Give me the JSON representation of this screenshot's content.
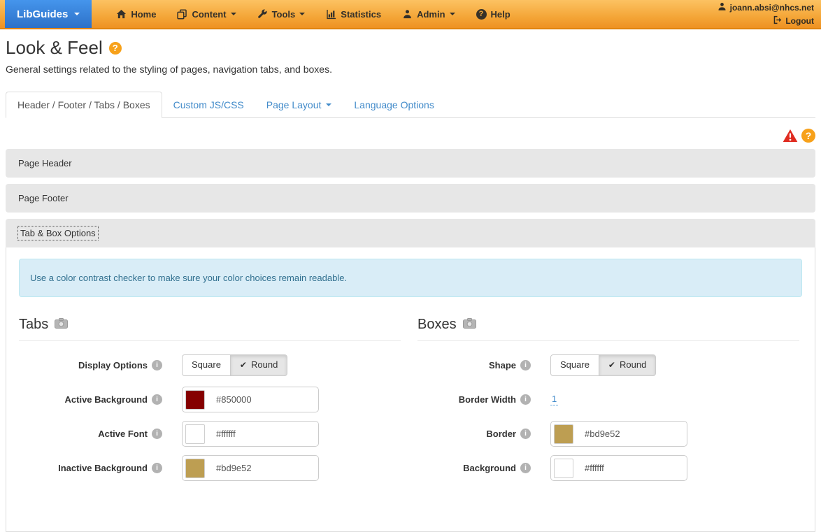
{
  "navbar": {
    "brand": "LibGuides",
    "items": [
      {
        "label": "Home",
        "icon": "home-icon"
      },
      {
        "label": "Content",
        "icon": "content-icon",
        "caret": true
      },
      {
        "label": "Tools",
        "icon": "tools-icon",
        "caret": true
      },
      {
        "label": "Statistics",
        "icon": "statistics-icon"
      },
      {
        "label": "Admin",
        "icon": "admin-icon",
        "caret": true
      },
      {
        "label": "Help",
        "icon": "help-icon"
      }
    ],
    "user_email": "joann.absi@nhcs.net",
    "logout_label": "Logout"
  },
  "page": {
    "title": "Look & Feel",
    "subtitle": "General settings related to the styling of pages, navigation tabs, and boxes."
  },
  "tabs": [
    {
      "label": "Header / Footer / Tabs / Boxes",
      "active": true
    },
    {
      "label": "Custom JS/CSS",
      "active": false
    },
    {
      "label": "Page Layout",
      "active": false,
      "caret": true
    },
    {
      "label": "Language Options",
      "active": false
    }
  ],
  "accordion": {
    "page_header": "Page Header",
    "page_footer": "Page Footer",
    "tab_box_options": "Tab & Box Options"
  },
  "alert": {
    "text": "Use a color contrast checker to make sure your color choices remain readable."
  },
  "tabs_section": {
    "heading": "Tabs",
    "fields": [
      {
        "label": "Display Options",
        "type": "toggle",
        "options": [
          "Square",
          "Round"
        ],
        "selected": "Round"
      },
      {
        "label": "Active Background",
        "value": "#850000",
        "swatch": "#850000"
      },
      {
        "label": "Active Font",
        "value": "#ffffff",
        "swatch": "#ffffff"
      },
      {
        "label": "Inactive Background",
        "value": "#bd9e52",
        "swatch": "#bd9e52"
      }
    ]
  },
  "boxes_section": {
    "heading": "Boxes",
    "fields": [
      {
        "label": "Shape",
        "type": "toggle",
        "options": [
          "Square",
          "Round"
        ],
        "selected": "Round"
      },
      {
        "label": "Border Width",
        "value": "1",
        "type": "editable"
      },
      {
        "label": "Border",
        "value": "#bd9e52",
        "swatch": "#bd9e52"
      },
      {
        "label": "Background",
        "value": "#ffffff",
        "swatch": "#ffffff"
      }
    ]
  },
  "icons": {
    "question": "?",
    "info": "i",
    "check": "✔"
  },
  "colors": {
    "navbar_orange_top": "#fcc262",
    "navbar_orange_bottom": "#ee9122",
    "brand_blue": "#3781d8",
    "link_blue": "#428bca",
    "help_orange": "#f7a11a",
    "warning_red": "#e02b20",
    "alert_bg": "#d9edf7",
    "alert_text": "#31708f",
    "accordion_gray": "#e7e7e7"
  }
}
